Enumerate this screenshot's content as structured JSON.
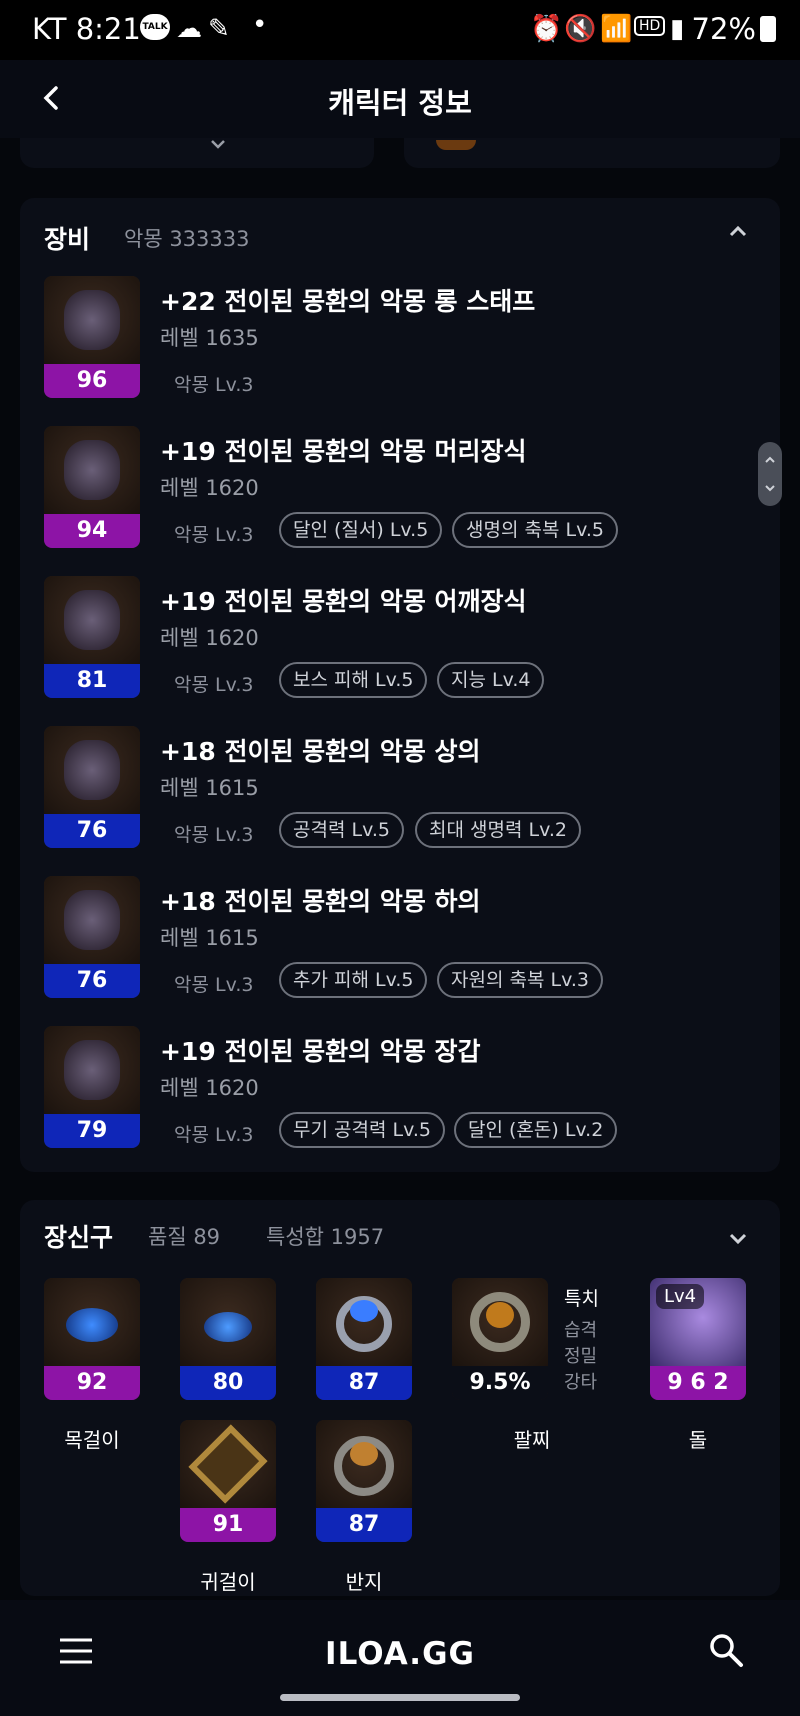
{
  "status_bar": {
    "carrier_time": "KT 8:21",
    "battery": "72%",
    "kakao": "TALK"
  },
  "header": {
    "title": "캐릭터 정보"
  },
  "equipment": {
    "title": "장비",
    "subtitle": "악몽 333333",
    "items": [
      {
        "name": "+22 전이된 몽환의 악몽 롱 스태프",
        "level": "레벨 1635",
        "quality": "96",
        "quality_color": "#8d14a6",
        "tier": "악몽 Lv.3",
        "chips": [],
        "icon": "staff-icon"
      },
      {
        "name": "+19 전이된 몽환의 악몽 머리장식",
        "level": "레벨 1620",
        "quality": "94",
        "quality_color": "#8d14a6",
        "tier": "악몽 Lv.3",
        "chips": [
          "달인 (질서) Lv.5",
          "생명의 축복 Lv.5"
        ],
        "icon": "hat-icon"
      },
      {
        "name": "+19 전이된 몽환의 악몽 어깨장식",
        "level": "레벨 1620",
        "quality": "81",
        "quality_color": "#0f26b8",
        "tier": "악몽 Lv.3",
        "chips": [
          "보스 피해 Lv.5",
          "지능 Lv.4"
        ],
        "icon": "shoulder-icon"
      },
      {
        "name": "+18 전이된 몽환의 악몽 상의",
        "level": "레벨 1615",
        "quality": "76",
        "quality_color": "#0f26b8",
        "tier": "악몽 Lv.3",
        "chips": [
          "공격력 Lv.5",
          "최대 생명력 Lv.2"
        ],
        "icon": "top-armor-icon"
      },
      {
        "name": "+18 전이된 몽환의 악몽 하의",
        "level": "레벨 1615",
        "quality": "76",
        "quality_color": "#0f26b8",
        "tier": "악몽 Lv.3",
        "chips": [
          "추가 피해 Lv.5",
          "자원의 축복 Lv.3"
        ],
        "icon": "pants-icon"
      },
      {
        "name": "+19 전이된 몽환의 악몽 장갑",
        "level": "레벨 1620",
        "quality": "79",
        "quality_color": "#0f26b8",
        "tier": "악몽 Lv.3",
        "chips": [
          "무기 공격력 Lv.5",
          "달인 (혼돈) Lv.2"
        ],
        "icon": "glove-icon"
      }
    ]
  },
  "accessories": {
    "title": "장신구",
    "quality": "품질 89",
    "stat_total": "특성합 1957",
    "necklace": {
      "label": "목걸이",
      "quality": "92"
    },
    "earring_1": {
      "quality": "80"
    },
    "ring_1": {
      "quality": "87"
    },
    "bracelet": {
      "label": "팔찌",
      "value": "9.5%",
      "stats": [
        "특치",
        "습격",
        "정밀",
        "강타"
      ]
    },
    "stone": {
      "label": "돌",
      "level": "Lv4",
      "value": "9 6 2"
    },
    "earring_2": {
      "label": "귀걸이",
      "quality": "91"
    },
    "ring_2": {
      "label": "반지",
      "quality": "87"
    }
  },
  "footer": {
    "logo": "ILOA.GG"
  }
}
